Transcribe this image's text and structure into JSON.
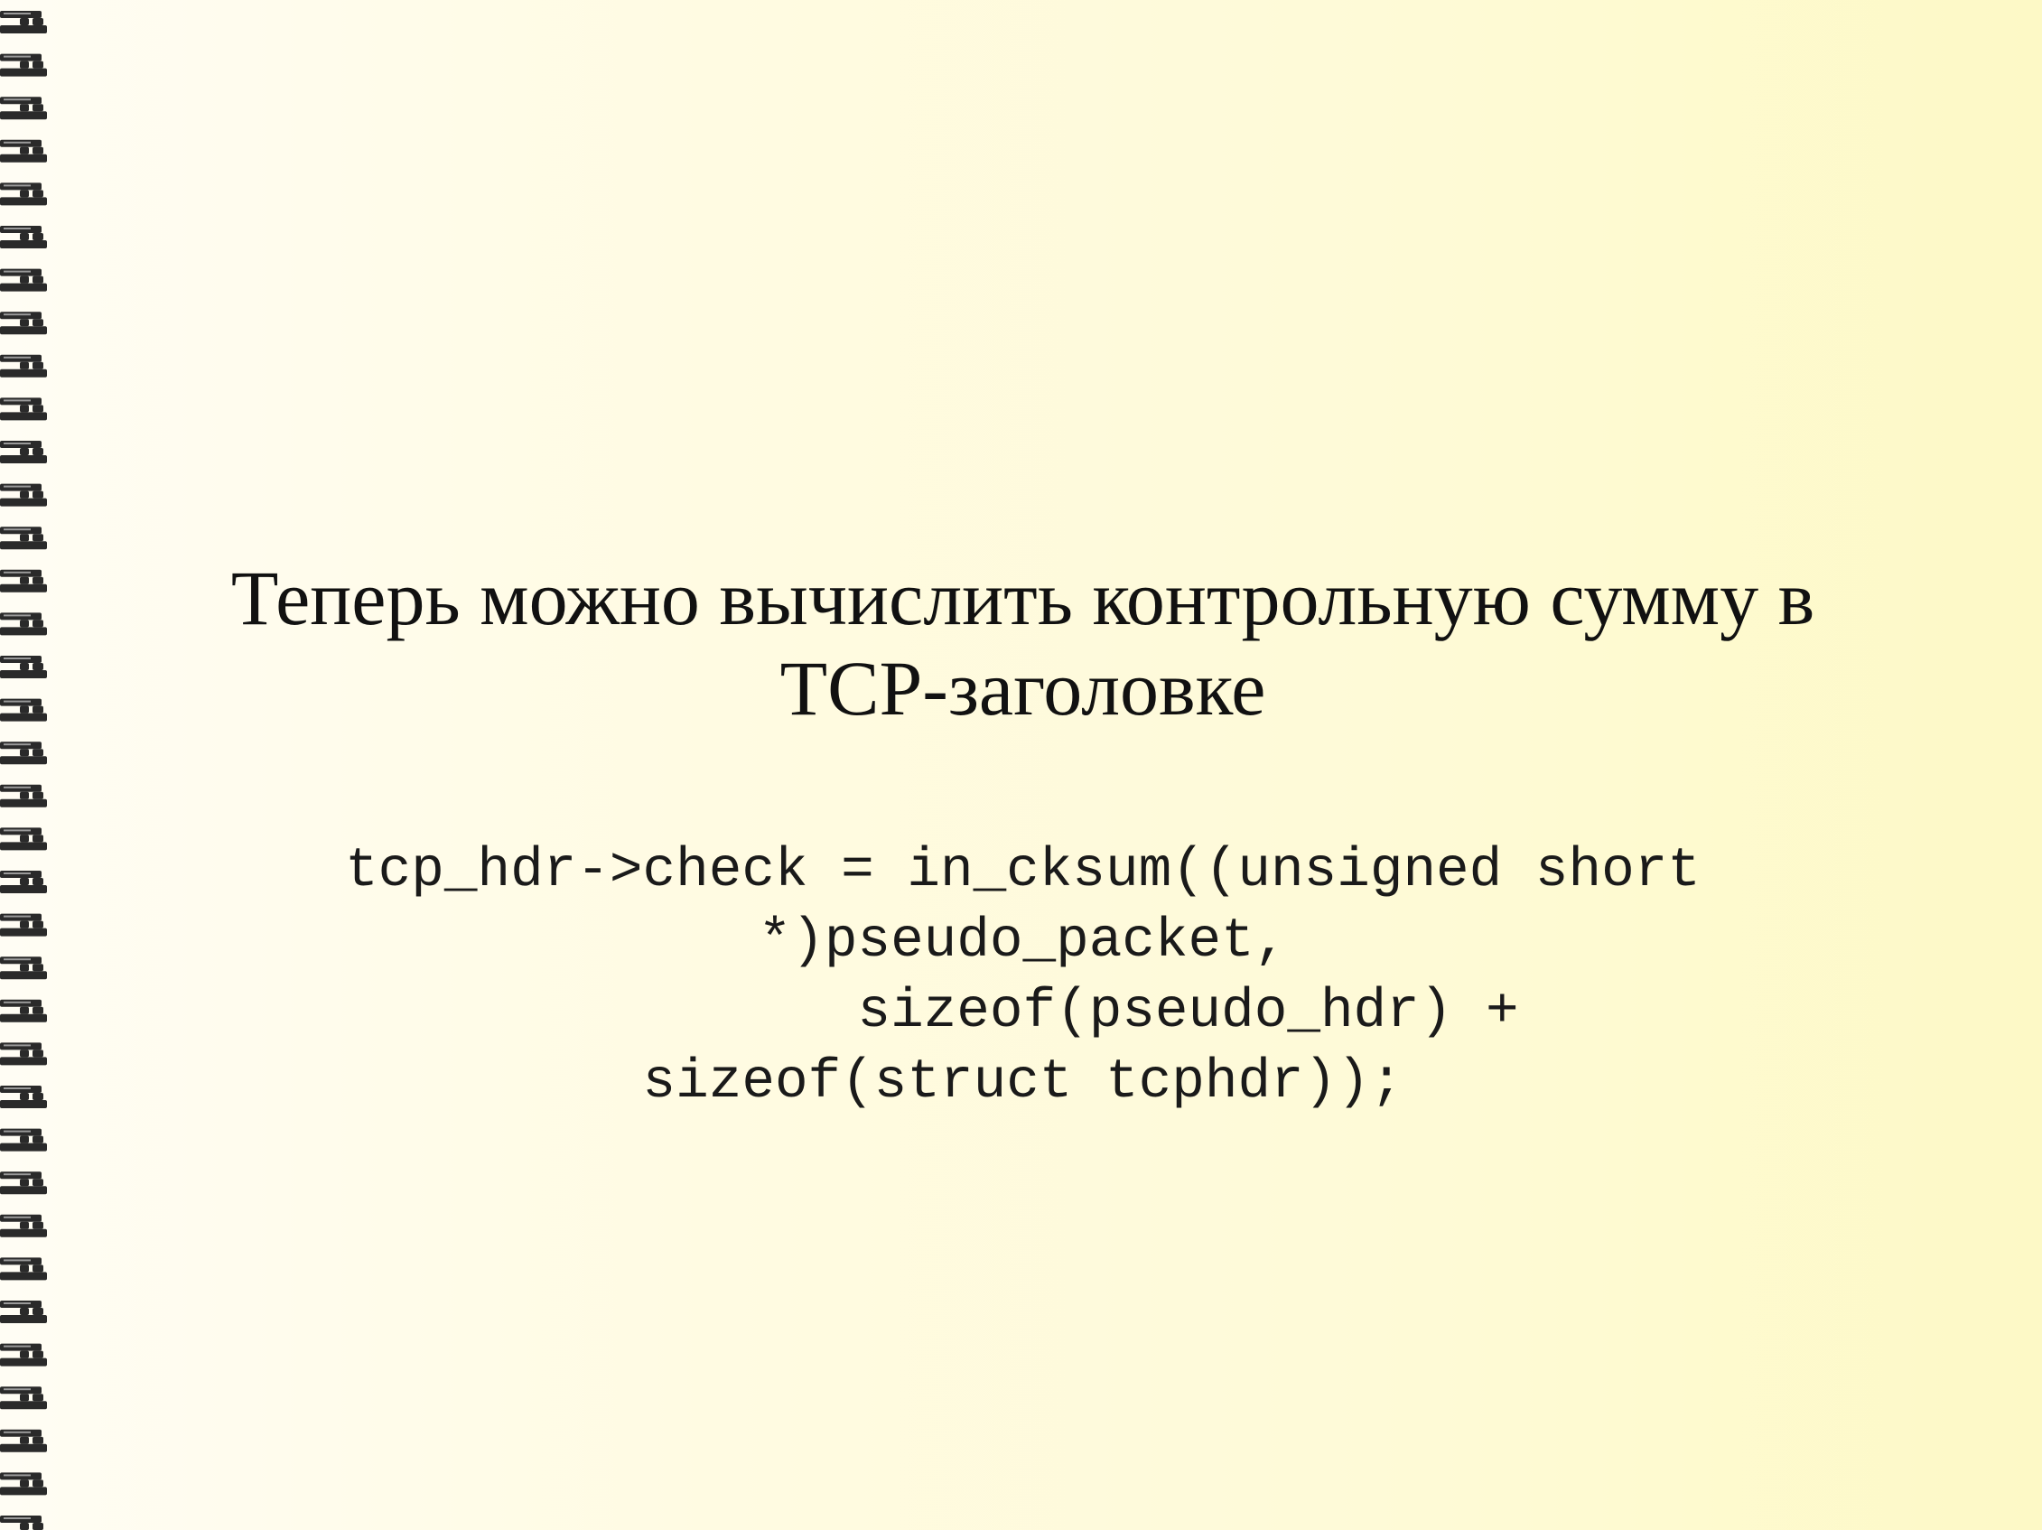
{
  "slide": {
    "title_lines": [
      "Теперь можно вычислить контрольную сумму в",
      "TCP-заголовке"
    ],
    "code_lines": [
      "tcp_hdr->check = in_cksum((unsigned short",
      "*)pseudo_packet,",
      "          sizeof(pseudo_hdr) +",
      "sizeof(struct tcphdr));"
    ]
  },
  "decoration": {
    "binding_icon": "spiral-binding-icon",
    "background_left": "#fffdf4",
    "background_right": "#fdf9c6",
    "binding_color": "#2a2a2a"
  }
}
